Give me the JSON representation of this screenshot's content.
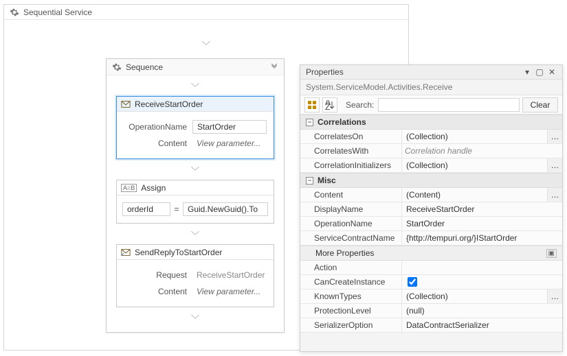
{
  "designer": {
    "outer_title": "Sequential Service",
    "sequence": {
      "title": "Sequence",
      "receive": {
        "title": "ReceiveStartOrder",
        "rows": {
          "opname_label": "OperationName",
          "opname_value": "StartOrder",
          "content_label": "Content",
          "content_link": "View parameter..."
        }
      },
      "assign": {
        "title": "Assign",
        "lhs": "orderId",
        "eq": "=",
        "rhs": "Guid.NewGuid().To"
      },
      "sendreply": {
        "title": "SendReplyToStartOrder",
        "rows": {
          "request_label": "Request",
          "request_value": "ReceiveStartOrder",
          "content_label": "Content",
          "content_link": "View parameter..."
        }
      }
    }
  },
  "props": {
    "title": "Properties",
    "subtitle": "System.ServiceModel.Activities.Receive",
    "search_label": "Search:",
    "search_value": "",
    "clear_label": "Clear",
    "cats": {
      "correlations": "Correlations",
      "misc": "Misc",
      "more": "More Properties"
    },
    "rows": {
      "CorrelatesOn": {
        "k": "CorrelatesOn",
        "v": "(Collection)",
        "ell": true
      },
      "CorrelatesWith": {
        "k": "CorrelatesWith",
        "v": "Correlation handle",
        "italic": true
      },
      "CorrelationInitializers": {
        "k": "CorrelationInitializers",
        "v": "(Collection)",
        "ell": true
      },
      "Content": {
        "k": "Content",
        "v": "(Content)",
        "ell": true
      },
      "DisplayName": {
        "k": "DisplayName",
        "v": "ReceiveStartOrder"
      },
      "OperationName": {
        "k": "OperationName",
        "v": "StartOrder"
      },
      "ServiceContractName": {
        "k": "ServiceContractName",
        "v": "{http://tempuri.org/}IStartOrder"
      },
      "Action": {
        "k": "Action",
        "v": ""
      },
      "CanCreateInstance": {
        "k": "CanCreateInstance",
        "checked": true
      },
      "KnownTypes": {
        "k": "KnownTypes",
        "v": "(Collection)",
        "ell": true
      },
      "ProtectionLevel": {
        "k": "ProtectionLevel",
        "v": "(null)"
      },
      "SerializerOption": {
        "k": "SerializerOption",
        "v": "DataContractSerializer"
      }
    }
  }
}
